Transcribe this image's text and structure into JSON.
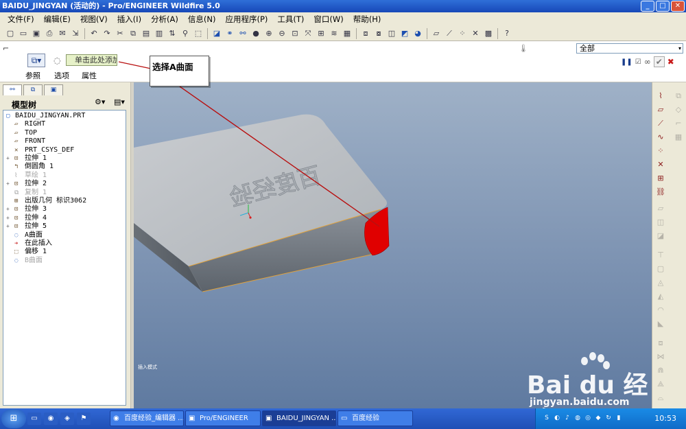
{
  "titlebar": {
    "title": "BAIDU_JINGYAN (活动的) - Pro/ENGINEER Wildfire 5.0",
    "buttons": {
      "minimize": "_",
      "maximize": "□",
      "close": "✕"
    }
  },
  "menubar": {
    "items": [
      "文件(F)",
      "编辑(E)",
      "视图(V)",
      "插入(I)",
      "分析(A)",
      "信息(N)",
      "应用程序(P)",
      "工具(T)",
      "窗口(W)",
      "帮助(H)"
    ]
  },
  "dashboard": {
    "collector_value": "单击此处添加",
    "tabs": [
      "参照",
      "选项",
      "属性"
    ],
    "filter_value": "全部",
    "filter_arrow": "▾",
    "actions": {
      "pause": "❚❚",
      "check_small": "☑",
      "preview": "∞",
      "ok": "✔",
      "cancel": "✖"
    }
  },
  "callout": {
    "text": "选择A曲面"
  },
  "left_panel": {
    "title": "模型树",
    "tree": [
      {
        "label": "BAIDU_JINGYAN.PRT",
        "icon": "part-icon",
        "glyph": "▢",
        "expander": "",
        "state": "root"
      },
      {
        "label": "RIGHT",
        "icon": "datum-plane-icon",
        "glyph": "▱",
        "expander": "",
        "state": "normal"
      },
      {
        "label": "TOP",
        "icon": "datum-plane-icon",
        "glyph": "▱",
        "expander": "",
        "state": "normal"
      },
      {
        "label": "FRONT",
        "icon": "datum-plane-icon",
        "glyph": "▱",
        "expander": "",
        "state": "normal"
      },
      {
        "label": "PRT_CSYS_DEF",
        "icon": "csys-icon",
        "glyph": "✕",
        "expander": "",
        "state": "normal"
      },
      {
        "label": "拉伸 1",
        "icon": "extrude-icon",
        "glyph": "⊡",
        "expander": "+",
        "state": "normal"
      },
      {
        "label": "倒圆角 1",
        "icon": "round-icon",
        "glyph": "↰",
        "expander": "",
        "state": "normal"
      },
      {
        "label": "草绘 1",
        "icon": "sketch-icon",
        "glyph": "⌇",
        "expander": "",
        "state": "greyed"
      },
      {
        "label": "拉伸 2",
        "icon": "extrude-icon",
        "glyph": "⊡",
        "expander": "+",
        "state": "normal"
      },
      {
        "label": "复制 1",
        "icon": "copy-icon",
        "glyph": "⧉",
        "expander": "",
        "state": "greyed"
      },
      {
        "label": "出版几何 标识3062",
        "icon": "publish-geometry-icon",
        "glyph": "⊞",
        "expander": "",
        "state": "normal"
      },
      {
        "label": "拉伸 3",
        "icon": "extrude-icon",
        "glyph": "⊡",
        "expander": "+",
        "state": "normal"
      },
      {
        "label": "拉伸 4",
        "icon": "extrude-icon",
        "glyph": "⊡",
        "expander": "+",
        "state": "normal"
      },
      {
        "label": "拉伸 5",
        "icon": "extrude-icon",
        "glyph": "⊡",
        "expander": "+",
        "state": "normal"
      },
      {
        "label": "A曲面",
        "icon": "surface-icon",
        "glyph": "◌",
        "expander": "",
        "state": "normal"
      },
      {
        "label": "在此插入",
        "icon": "insert-here-arrow-icon",
        "glyph": "➔",
        "expander": "",
        "state": "insert"
      },
      {
        "label": "偏移 1",
        "icon": "offset-icon",
        "glyph": "⬚",
        "expander": "",
        "state": "normal"
      },
      {
        "label": "B曲面",
        "icon": "surface-icon",
        "glyph": "◌",
        "expander": "",
        "state": "greyed"
      }
    ]
  },
  "viewport": {
    "status_text": "插入模式",
    "highlight_color": "#e00000",
    "body_color": "#b9bec4",
    "edge_color": "#e2a23a"
  },
  "taskbar": {
    "start_glyph": "⊞",
    "tasks": [
      {
        "label": "百度经验_编辑器 ...",
        "icon": "browser-icon",
        "glyph": "◉",
        "active": false
      },
      {
        "label": "Pro/ENGINEER",
        "icon": "proe-icon",
        "glyph": "▣",
        "active": false
      },
      {
        "label": "BAIDU_JINGYAN ...",
        "icon": "proe-icon",
        "glyph": "▣",
        "active": true
      },
      {
        "label": "百度经验",
        "icon": "folder-icon",
        "glyph": "▭",
        "active": false
      }
    ],
    "clock": "10:53"
  },
  "watermark": {
    "logo": "Bai du 经验",
    "url": "jingyan.baidu.com"
  }
}
